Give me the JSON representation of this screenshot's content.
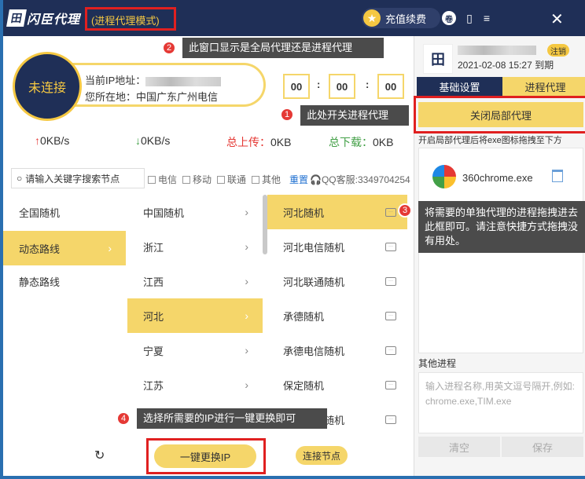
{
  "titlebar": {
    "logo_mark": "田",
    "logo_text": "闪臣代理",
    "mode": "(进程代理模式)",
    "recharge": "充值续费",
    "icons": [
      "star-icon",
      "headset-icon",
      "phone-icon",
      "menu-icon",
      "close-icon"
    ]
  },
  "callouts": {
    "c1": {
      "num": "1",
      "text": "此处开关进程代理"
    },
    "c2": {
      "num": "2",
      "text": "此窗口显示是全局代理还是进程代理"
    },
    "c3": {
      "num": "3",
      "text": "将需要的单独代理的进程拖拽进去此框即可。请注意快捷方式拖拽没有用处。"
    },
    "c4": {
      "num": "4",
      "text": "选择所需要的IP进行一键更换即可"
    }
  },
  "status": {
    "state": "未连接",
    "ip_label": "当前IP地址：",
    "location_label": "您所在地：",
    "location_value": "中国广东广州电信",
    "timer": [
      "00",
      "00",
      "00"
    ]
  },
  "speeds": {
    "up": "0KB/s",
    "down": "0KB/s",
    "total_up_label": "总上传：",
    "total_up": "0KB",
    "total_down_label": "总下载：",
    "total_down": "0KB"
  },
  "search": {
    "placeholder": "请输入关键字搜索节点",
    "filters": [
      "电信",
      "移动",
      "联通",
      "其他"
    ],
    "reset": "重置",
    "qq": "QQ客服:3349704254"
  },
  "col1": [
    "全国随机",
    "动态路线",
    "静态路线"
  ],
  "col2": [
    "中国随机",
    "浙江",
    "江西",
    "河北",
    "宁夏",
    "江苏"
  ],
  "col3": [
    "河北随机",
    "河北电信随机",
    "河北联通随机",
    "承德随机",
    "承德电信随机",
    "保定随机",
    "保定电信随机"
  ],
  "actions": {
    "switch_ip": "一键更换IP",
    "connect_node": "连接节点"
  },
  "right": {
    "logout": "注销",
    "expire": "2021-02-08 15:27 到期",
    "tab_basic": "基础设置",
    "tab_process": "进程代理",
    "close_local": "关闭局部代理",
    "hint": "开启局部代理后将exe图标拖拽至下方",
    "process": "360chrome.exe",
    "other_label": "其他进程",
    "other_placeholder": "输入进程名称,用英文逗号隔开,例如: chrome.exe,TIM.exe",
    "clear": "清空",
    "save": "保存"
  },
  "colors": {
    "titlebar": "#1f2f57",
    "accent": "#f5d66a",
    "highlight": "#e02020"
  }
}
